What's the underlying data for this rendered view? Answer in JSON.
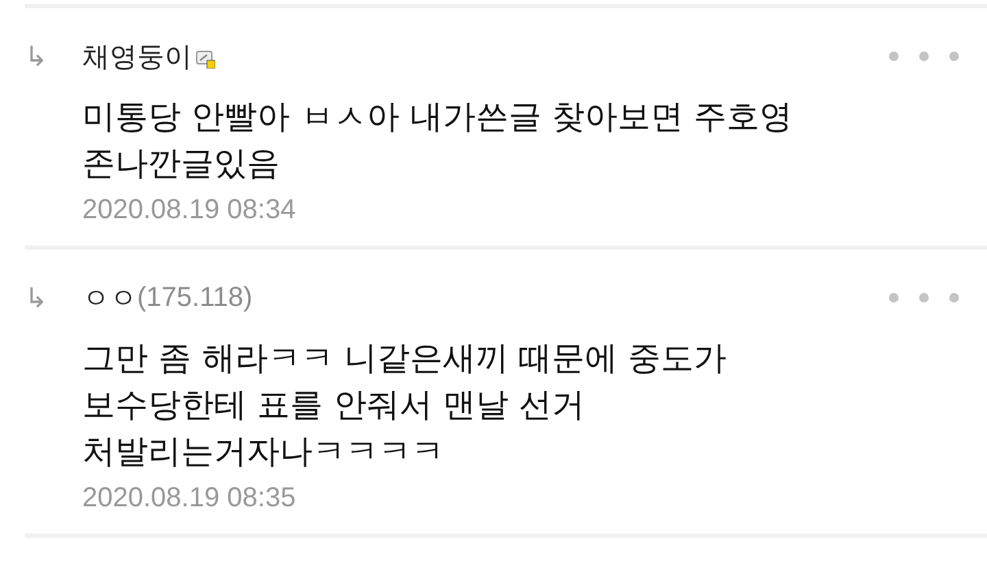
{
  "comments": [
    {
      "reply_marker": "↳",
      "author": "채영둥이",
      "member_icon": true,
      "body": "미통당 안빨아 ㅂㅅ아 내가쓴글 찾아보면 주호영\n존나깐글있음",
      "date": "2020.08.19 08:34"
    },
    {
      "reply_marker": "↳",
      "author": "ㅇㅇ",
      "ip": "(175.118)",
      "member_icon": false,
      "body": "그만 좀 해라ㅋㅋ 니같은새끼 때문에 중도가\n보수당한테 표를 안줘서 맨날 선거\n처발리는거자나ㅋㅋㅋㅋ",
      "date": "2020.08.19 08:35"
    }
  ]
}
